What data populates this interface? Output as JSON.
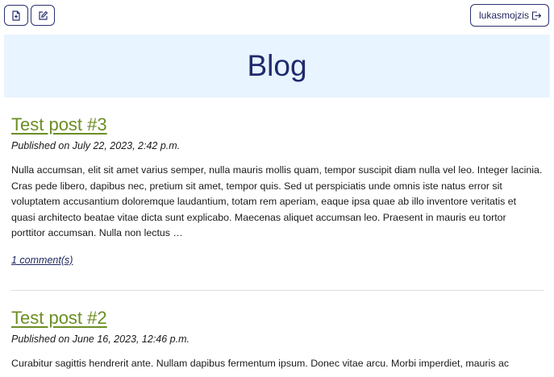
{
  "toolbar": {
    "new_post_icon": "file-plus-icon",
    "edit_icon": "pencil-square-icon"
  },
  "user": {
    "username": "lukasmojzis",
    "logout_icon": "logout-icon"
  },
  "header": {
    "title": "Blog"
  },
  "posts": [
    {
      "title": "Test post #3",
      "date": "Published on July 22, 2023, 2:42 p.m.",
      "lines": [
        "Nulla accumsan, elit sit amet varius semper, nulla mauris mollis quam, tempor suscipit diam nulla vel leo. Integer lacinia.",
        "Cras pede libero, dapibus nec, pretium sit amet, tempor quis. Sed ut perspiciatis unde omnis iste natus error sit",
        "voluptatem accusantium doloremque laudantium, totam rem aperiam, eaque ipsa quae ab illo inventore veritatis et",
        "quasi architecto beatae vitae dicta sunt explicabo. Maecenas aliquet accumsan leo. Praesent in mauris eu tortor",
        "porttitor accumsan. Nulla non lectus …"
      ],
      "comments": "1 comment(s)"
    },
    {
      "title": "Test post #2",
      "date": "Published on June 16, 2023, 12:46 p.m.",
      "lines": [
        "Curabitur sagittis hendrerit ante. Nullam dapibus fermentum ipsum. Donec vitae arcu. Morbi imperdiet, mauris ac"
      ]
    }
  ]
}
